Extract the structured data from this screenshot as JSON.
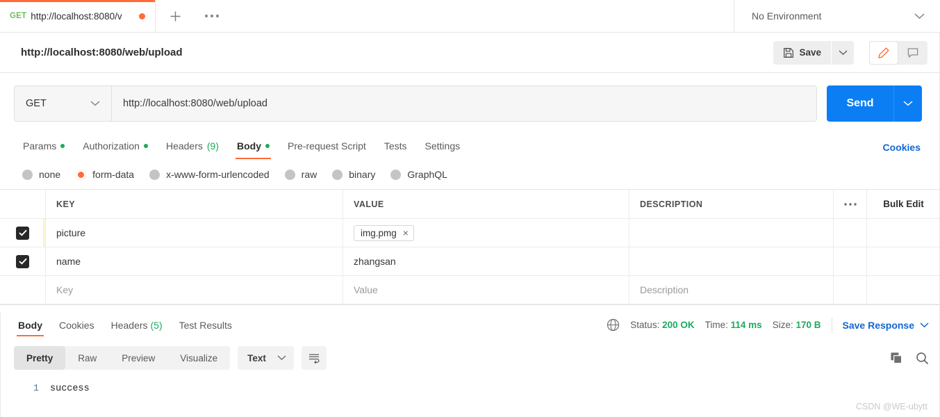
{
  "tabstrip": {
    "request_tab": {
      "method": "GET",
      "url": "http://localhost:8080/v",
      "unsaved_dot": "unsaved"
    },
    "new_tab_label": "+",
    "more_label": "●●●",
    "environment": {
      "selected": "No Environment"
    }
  },
  "namerow": {
    "request_name": "http://localhost:8080/web/upload",
    "save_label": "Save",
    "save_caret": "⌄",
    "edit_icon": "pencil-icon",
    "comment_icon": "comment-icon"
  },
  "urlbar": {
    "method": "GET",
    "url": "http://localhost:8080/web/upload",
    "send_label": "Send"
  },
  "request_tabs": {
    "items": [
      {
        "label": "Params",
        "dot": true,
        "active": false
      },
      {
        "label": "Authorization",
        "dot": true,
        "active": false
      },
      {
        "label": "Headers",
        "count": "(9)",
        "active": false
      },
      {
        "label": "Body",
        "dot": true,
        "active": true
      },
      {
        "label": "Pre-request Script",
        "active": false
      },
      {
        "label": "Tests",
        "active": false
      },
      {
        "label": "Settings",
        "active": false
      }
    ],
    "cookies_label": "Cookies"
  },
  "body_types": {
    "options": [
      {
        "label": "none",
        "selected": false
      },
      {
        "label": "form-data",
        "selected": true
      },
      {
        "label": "x-www-form-urlencoded",
        "selected": false
      },
      {
        "label": "raw",
        "selected": false
      },
      {
        "label": "binary",
        "selected": false
      },
      {
        "label": "GraphQL",
        "selected": false
      }
    ],
    "accent": "#ff6c37"
  },
  "kv_table": {
    "headers": {
      "key": "KEY",
      "value": "VALUE",
      "description": "DESCRIPTION",
      "more": "●●●",
      "bulk_edit": "Bulk Edit"
    },
    "rows": [
      {
        "checked": true,
        "key": "picture",
        "value": "img.pmg",
        "value_type": "file",
        "chip_close": "×",
        "description": ""
      },
      {
        "checked": true,
        "key": "name",
        "value": "zhangsan",
        "value_type": "text",
        "description": ""
      }
    ],
    "placeholder_row": {
      "key": "Key",
      "value": "Value",
      "description": "Description"
    }
  },
  "response": {
    "tabs": [
      {
        "label": "Body",
        "active": true
      },
      {
        "label": "Cookies",
        "active": false
      },
      {
        "label": "Headers",
        "count": "(5)",
        "active": false
      },
      {
        "label": "Test Results",
        "active": false
      }
    ],
    "globe_icon": "globe-icon",
    "status_label": "Status:",
    "status_value": "200 OK",
    "time_label": "Time:",
    "time_value": "114 ms",
    "size_label": "Size:",
    "size_value": "170 B",
    "save_response_label": "Save Response",
    "save_response_caret": "⌄",
    "view_modes": [
      {
        "label": "Pretty",
        "active": true
      },
      {
        "label": "Raw",
        "active": false
      },
      {
        "label": "Preview",
        "active": false
      },
      {
        "label": "Visualize",
        "active": false
      }
    ],
    "format": "Text",
    "format_caret": "⌄",
    "wrap_icon": "wrap-lines-icon",
    "copy_icon": "copy-icon",
    "search_icon": "search-icon",
    "body_lines": [
      {
        "n": "1",
        "text": "success"
      }
    ]
  },
  "watermark": "CSDN @WE-ubytt",
  "colors": {
    "orange": "#ff6c37",
    "blue": "#0b7ef4",
    "green": "#1bab5c",
    "link": "#1266d4"
  }
}
